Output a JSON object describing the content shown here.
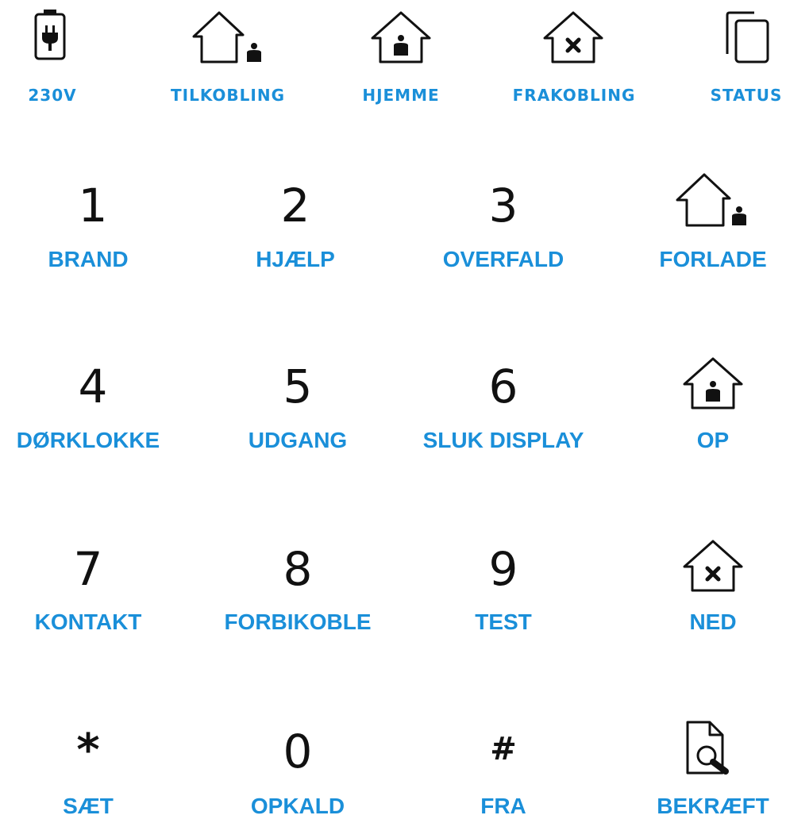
{
  "top_row": [
    {
      "label": "230V",
      "icon": "battery-plug-icon"
    },
    {
      "label": "TILKOBLING",
      "icon": "house-person-outside-icon"
    },
    {
      "label": "HJEMME",
      "icon": "house-person-inside-icon"
    },
    {
      "label": "FRAKOBLING",
      "icon": "house-x-icon"
    },
    {
      "label": "STATUS",
      "icon": "copy-pages-icon"
    }
  ],
  "keys": [
    {
      "key": "1",
      "label": "BRAND"
    },
    {
      "key": "2",
      "label": "HJÆLP"
    },
    {
      "key": "3",
      "label": "OVERFALD"
    },
    {
      "icon": "house-person-outside-icon",
      "label": "FORLADE"
    },
    {
      "key": "4",
      "label": "DØRKLOKKE"
    },
    {
      "key": "5",
      "label": "UDGANG"
    },
    {
      "key": "6",
      "label": "SLUK DISPLAY"
    },
    {
      "icon": "house-person-inside-icon",
      "label": "OP"
    },
    {
      "key": "7",
      "label": "KONTAKT"
    },
    {
      "key": "8",
      "label": "FORBIKOBLE"
    },
    {
      "key": "9",
      "label": "TEST"
    },
    {
      "icon": "house-x-icon",
      "label": "NED"
    },
    {
      "key": "*",
      "label": "SÆT"
    },
    {
      "key": "0",
      "label": "OPKALD"
    },
    {
      "key": "#",
      "label": "FRA"
    },
    {
      "icon": "document-search-icon",
      "label": "BEKRÆFT"
    }
  ],
  "colors": {
    "label": "#1a8fd9",
    "glyph": "#111111"
  }
}
